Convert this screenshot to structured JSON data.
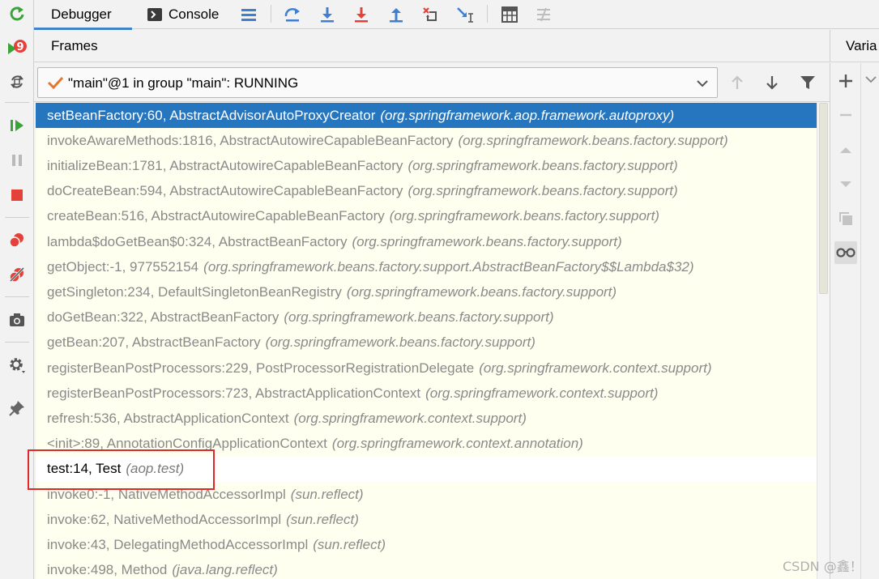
{
  "tabs": {
    "debugger": "Debugger",
    "console": "Console"
  },
  "frames_panel": {
    "title": "Frames",
    "thread_selector": "\"main\"@1 in group \"main\": RUNNING"
  },
  "variables_panel": {
    "title": "Varia"
  },
  "left_toolbar": {
    "restart_badge": "9"
  },
  "frames": [
    {
      "method": "setBeanFactory:60, AbstractAdvisorAutoProxyCreator",
      "package": "(org.springframework.aop.framework.autoproxy)"
    },
    {
      "method": "invokeAwareMethods:1816, AbstractAutowireCapableBeanFactory",
      "package": "(org.springframework.beans.factory.support)"
    },
    {
      "method": "initializeBean:1781, AbstractAutowireCapableBeanFactory",
      "package": "(org.springframework.beans.factory.support)"
    },
    {
      "method": "doCreateBean:594, AbstractAutowireCapableBeanFactory",
      "package": "(org.springframework.beans.factory.support)"
    },
    {
      "method": "createBean:516, AbstractAutowireCapableBeanFactory",
      "package": "(org.springframework.beans.factory.support)"
    },
    {
      "method": "lambda$doGetBean$0:324, AbstractBeanFactory",
      "package": "(org.springframework.beans.factory.support)"
    },
    {
      "method": "getObject:-1, 977552154",
      "package": "(org.springframework.beans.factory.support.AbstractBeanFactory$$Lambda$32)"
    },
    {
      "method": "getSingleton:234, DefaultSingletonBeanRegistry",
      "package": "(org.springframework.beans.factory.support)"
    },
    {
      "method": "doGetBean:322, AbstractBeanFactory",
      "package": "(org.springframework.beans.factory.support)"
    },
    {
      "method": "getBean:207, AbstractBeanFactory",
      "package": "(org.springframework.beans.factory.support)"
    },
    {
      "method": "registerBeanPostProcessors:229, PostProcessorRegistrationDelegate",
      "package": "(org.springframework.context.support)"
    },
    {
      "method": "registerBeanPostProcessors:723, AbstractApplicationContext",
      "package": "(org.springframework.context.support)"
    },
    {
      "method": "refresh:536, AbstractApplicationContext",
      "package": "(org.springframework.context.support)"
    },
    {
      "method": "<init>:89, AnnotationConfigApplicationContext",
      "package": "(org.springframework.context.annotation)"
    },
    {
      "method": "test:14, Test",
      "package": "(aop.test)"
    },
    {
      "method": "invoke0:-1, NativeMethodAccessorImpl",
      "package": "(sun.reflect)"
    },
    {
      "method": "invoke:62, NativeMethodAccessorImpl",
      "package": "(sun.reflect)"
    },
    {
      "method": "invoke:43, DelegatingMethodAccessorImpl",
      "package": "(sun.reflect)"
    },
    {
      "method": "invoke:498, Method",
      "package": "(java.lang.reflect)"
    }
  ],
  "watermark": "CSDN @鑫！"
}
